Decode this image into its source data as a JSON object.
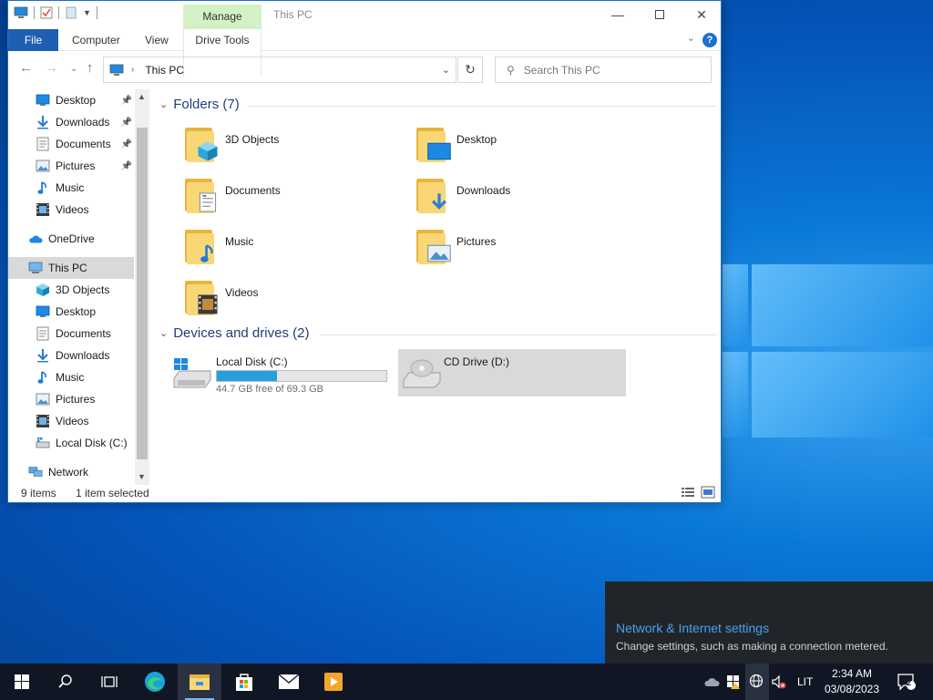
{
  "window": {
    "title": "This PC",
    "context_tab": "Manage",
    "tabs": {
      "file": "File",
      "computer": "Computer",
      "view": "View",
      "drive_tools": "Drive Tools"
    },
    "help": "?"
  },
  "address": {
    "crumb": "This PC",
    "search_placeholder": "Search This PC"
  },
  "nav": [
    {
      "label": "Desktop",
      "icon": "desktop-icon",
      "pinned": true
    },
    {
      "label": "Downloads",
      "icon": "download-arrow-icon",
      "pinned": true
    },
    {
      "label": "Documents",
      "icon": "document-icon",
      "pinned": true
    },
    {
      "label": "Pictures",
      "icon": "picture-icon",
      "pinned": true
    },
    {
      "label": "Music",
      "icon": "music-note-icon",
      "pinned": false
    },
    {
      "label": "Videos",
      "icon": "film-icon",
      "pinned": false
    },
    {
      "label": "OneDrive",
      "icon": "cloud-icon",
      "pinned": false
    },
    {
      "label": "This PC",
      "icon": "computer-icon",
      "pinned": false,
      "selected": true
    },
    {
      "label": "3D Objects",
      "icon": "cube-icon",
      "pinned": false
    },
    {
      "label": "Desktop",
      "icon": "desktop-icon",
      "pinned": false
    },
    {
      "label": "Documents",
      "icon": "document-icon",
      "pinned": false
    },
    {
      "label": "Downloads",
      "icon": "download-arrow-icon",
      "pinned": false
    },
    {
      "label": "Music",
      "icon": "music-note-icon",
      "pinned": false
    },
    {
      "label": "Pictures",
      "icon": "picture-icon",
      "pinned": false
    },
    {
      "label": "Videos",
      "icon": "film-icon",
      "pinned": false
    },
    {
      "label": "Local Disk (C:)",
      "icon": "drive-icon",
      "pinned": false
    },
    {
      "label": "Network",
      "icon": "network-icon",
      "pinned": false
    }
  ],
  "folders_header": "Folders (7)",
  "folders": [
    {
      "label": "3D Objects",
      "icon": "cube-icon"
    },
    {
      "label": "Desktop",
      "icon": "desktop-icon"
    },
    {
      "label": "Documents",
      "icon": "document-icon"
    },
    {
      "label": "Downloads",
      "icon": "download-arrow-icon"
    },
    {
      "label": "Music",
      "icon": "music-note-icon"
    },
    {
      "label": "Pictures",
      "icon": "picture-icon"
    },
    {
      "label": "Videos",
      "icon": "film-icon"
    }
  ],
  "drives_header": "Devices and drives (2)",
  "drives": [
    {
      "label": "Local Disk (C:)",
      "free_text": "44.7 GB free of 69.3 GB",
      "used_fraction": 0.355
    },
    {
      "label": "CD Drive (D:)",
      "selected": true
    }
  ],
  "status": {
    "items": "9 items",
    "selected": "1 item selected"
  },
  "flyout": {
    "link": "Network & Internet settings",
    "desc": "Change settings, such as making a connection metered."
  },
  "taskbar": {
    "lang": "LIT",
    "time": "2:34 AM",
    "date": "03/08/2023",
    "notifications": "2"
  },
  "colors": {
    "accent": "#1e5fb3",
    "context_tab": "#d4f1c6",
    "progress": "#26a0da",
    "taskbar": "#101623"
  }
}
